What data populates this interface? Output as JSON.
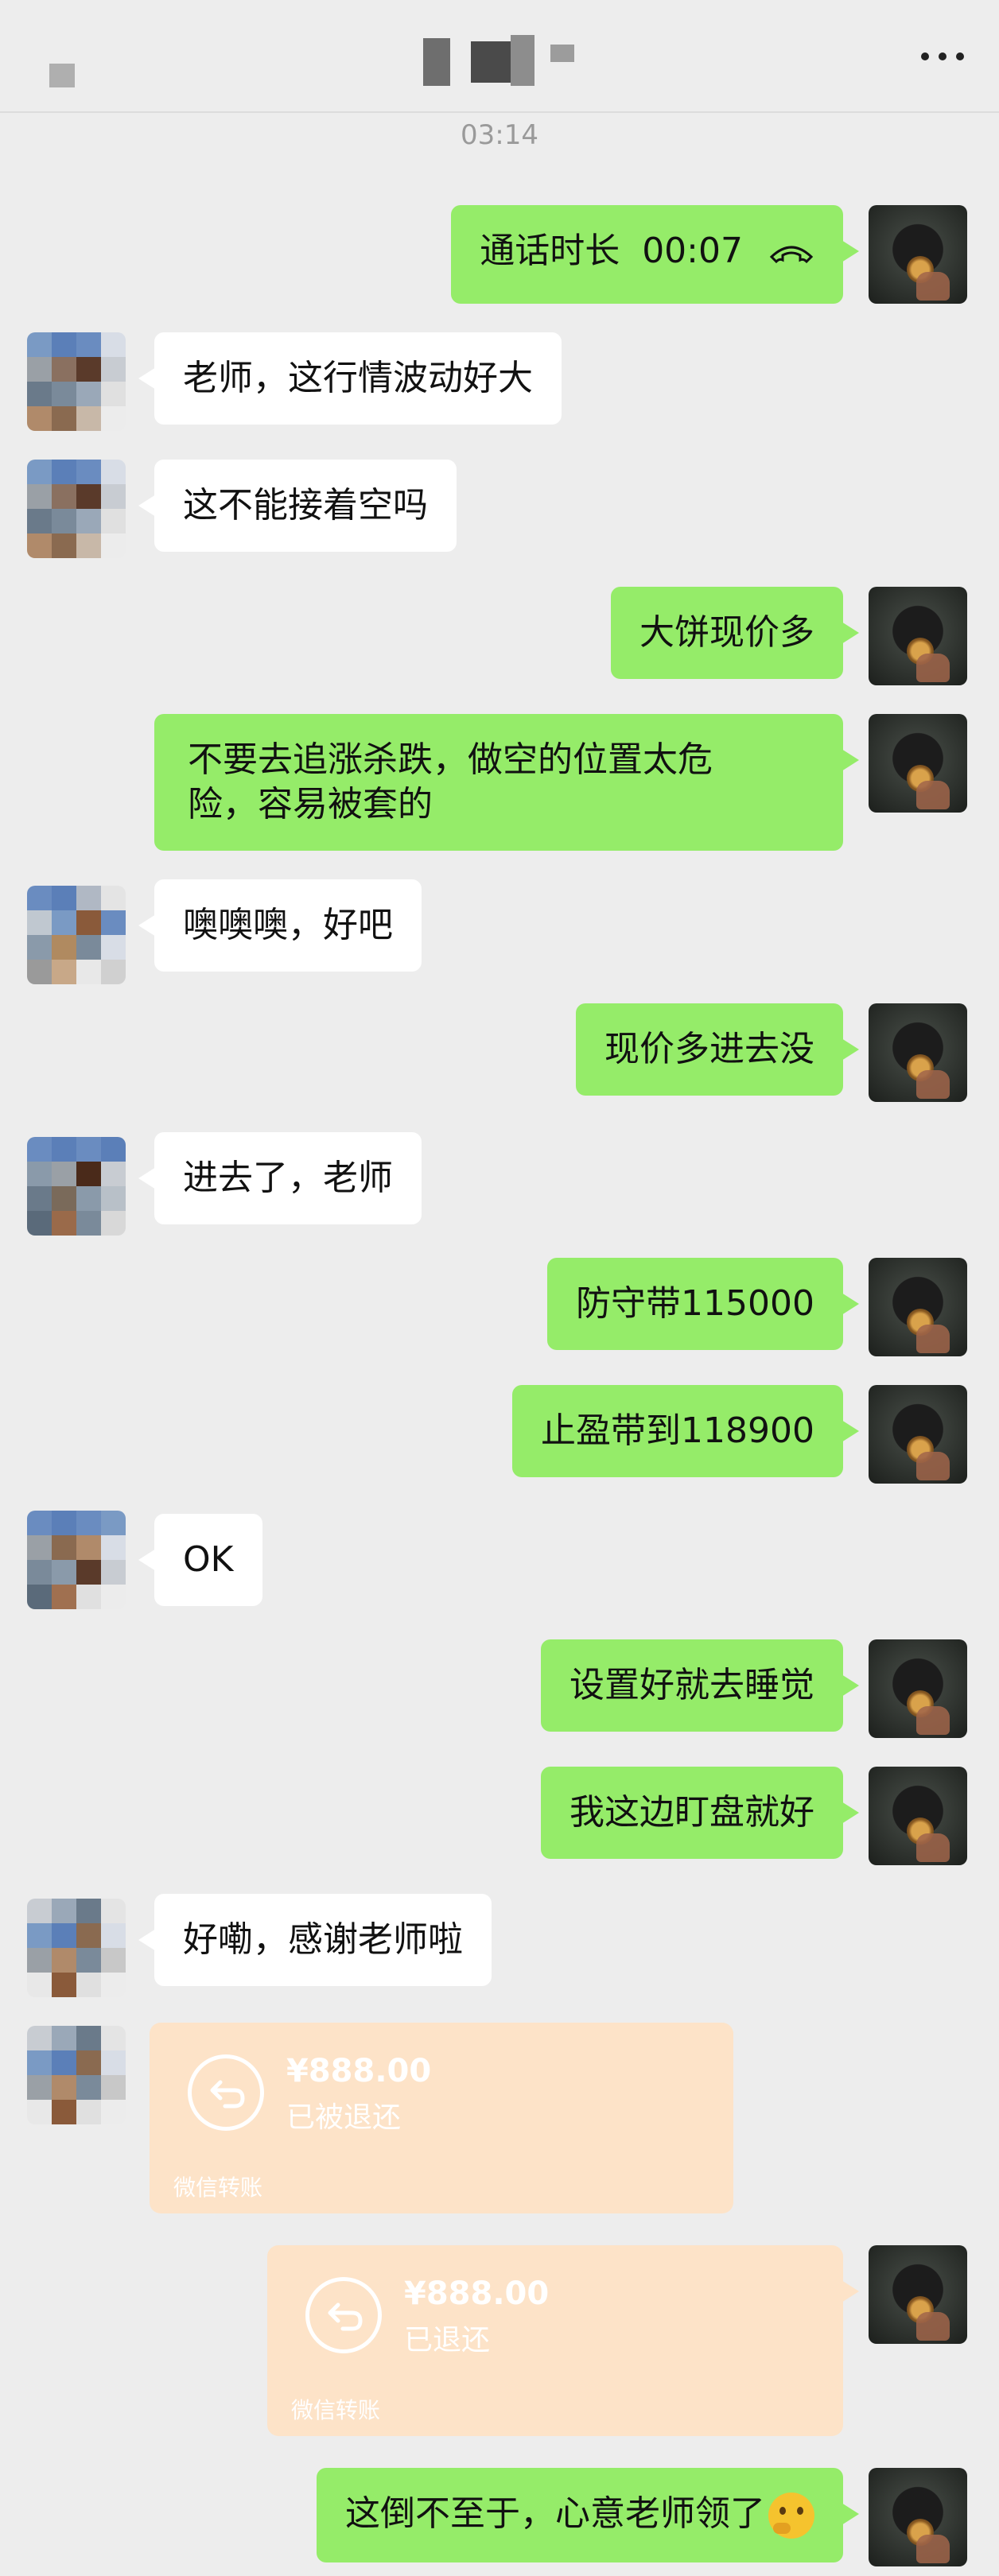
{
  "header": {
    "title": "",
    "menu_icon": "more-dots-icon"
  },
  "timestamp": "03:14",
  "messages": [
    {
      "id": "m1",
      "side": "self",
      "text": "通话时长  00:07",
      "icon": "phone-hangup-icon"
    },
    {
      "id": "m2",
      "side": "other",
      "text": "老师，这行情波动好大"
    },
    {
      "id": "m3",
      "side": "other",
      "text": "这不能接着空吗"
    },
    {
      "id": "m4",
      "side": "self",
      "text": "大饼现价多"
    },
    {
      "id": "m5",
      "side": "self",
      "lines": [
        "不要去追涨杀跌，做空的位置太危",
        "险，容易被套的"
      ]
    },
    {
      "id": "m6",
      "side": "other",
      "text": "噢噢噢，好吧"
    },
    {
      "id": "m7",
      "side": "self",
      "text": "现价多进去没"
    },
    {
      "id": "m8",
      "side": "other",
      "text": "进去了，老师"
    },
    {
      "id": "m9",
      "side": "self",
      "text": "防守带115000"
    },
    {
      "id": "m10",
      "side": "self",
      "text": "止盈带到118900"
    },
    {
      "id": "m11",
      "side": "other",
      "text": "OK"
    },
    {
      "id": "m12",
      "side": "self",
      "text": "设置好就去睡觉"
    },
    {
      "id": "m13",
      "side": "self",
      "text": "我这边盯盘就好"
    },
    {
      "id": "m14",
      "side": "other",
      "text": "好嘞，感谢老师啦"
    },
    {
      "id": "m15",
      "side": "other",
      "type": "transfer",
      "amount": "¥888.00",
      "status": "已被退还",
      "source": "微信转账"
    },
    {
      "id": "m16",
      "side": "self",
      "type": "transfer",
      "amount": "¥888.00",
      "status": "已退还",
      "source": "微信转账"
    },
    {
      "id": "m17",
      "side": "self",
      "text": "这倒不至于，心意老师领了",
      "emoji": "thinking-face-icon"
    }
  ],
  "colors": {
    "self_bubble": "#95ec69",
    "other_bubble": "#ffffff",
    "transfer": "#fde3c8",
    "background": "#ededed"
  }
}
